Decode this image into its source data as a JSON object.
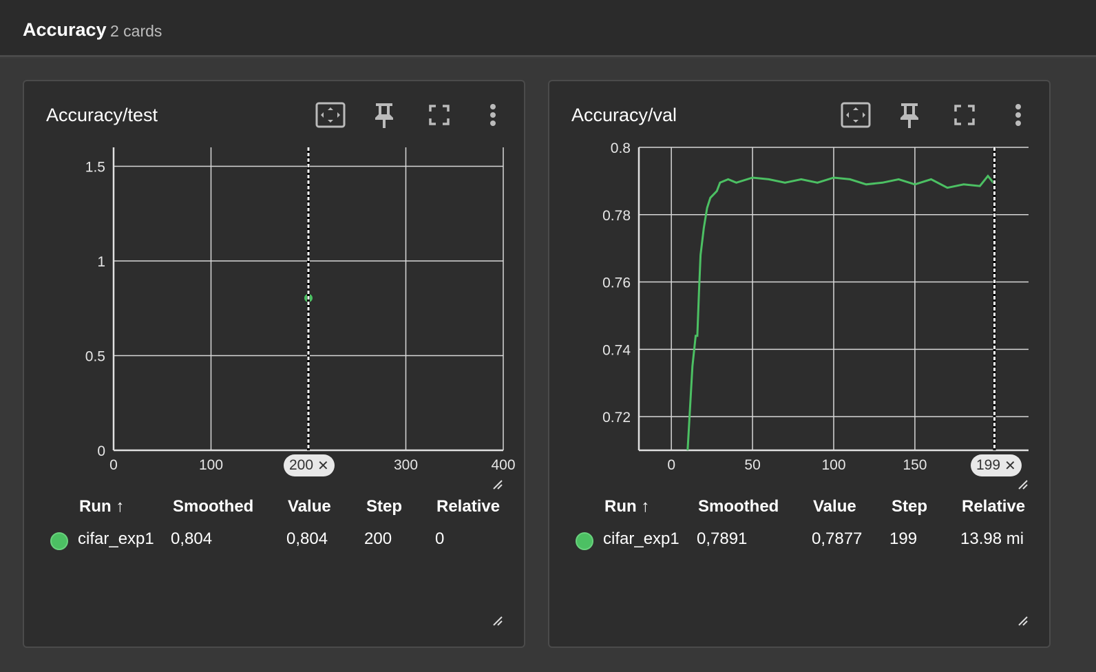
{
  "header": {
    "title": "Accuracy",
    "count": "2 cards"
  },
  "colors": {
    "series": "#4cc063",
    "grid": "#d8d8d8",
    "bg": "#2d2d2d"
  },
  "icons": [
    "fit-domain-icon",
    "pin-icon",
    "fullscreen-icon",
    "more-vert-icon"
  ],
  "cards": [
    {
      "title": "Accuracy/test",
      "chart_data": {
        "type": "scatter",
        "title": "Accuracy/test",
        "x_ticks": [
          "0",
          "100",
          "200",
          "300",
          "400"
        ],
        "y_ticks": [
          "0",
          "0.5",
          "1",
          "1.5"
        ],
        "xlim": [
          0,
          400
        ],
        "ylim": [
          0,
          1.6
        ],
        "series": [
          {
            "name": "cifar_exp1",
            "x": [
              200
            ],
            "y": [
              0.804
            ]
          }
        ],
        "cursor_step": "200"
      },
      "table": {
        "headers": [
          "Run ↑",
          "Smoothed",
          "Value",
          "Step",
          "Relative"
        ],
        "rows": [
          {
            "run": "cifar_exp1",
            "smoothed": "0,804",
            "value": "0,804",
            "step": "200",
            "relative": "0"
          }
        ]
      }
    },
    {
      "title": "Accuracy/val",
      "chart_data": {
        "type": "line",
        "title": "Accuracy/val",
        "x_ticks": [
          "0",
          "50",
          "100",
          "150",
          "199"
        ],
        "y_ticks": [
          "0.72",
          "0.74",
          "0.76",
          "0.78",
          "0.8"
        ],
        "xlim": [
          -20,
          220
        ],
        "ylim": [
          0.71,
          0.8
        ],
        "series": [
          {
            "name": "cifar_exp1",
            "x": [
              10,
              13,
              15,
              16,
              17,
              18,
              20,
              22,
              24,
              26,
              28,
              30,
              35,
              40,
              50,
              60,
              70,
              80,
              90,
              100,
              110,
              120,
              130,
              140,
              150,
              160,
              170,
              180,
              190,
              195,
              199
            ],
            "y": [
              0.71,
              0.735,
              0.744,
              0.744,
              0.757,
              0.768,
              0.776,
              0.782,
              0.785,
              0.786,
              0.787,
              0.7895,
              0.7905,
              0.7895,
              0.791,
              0.7905,
              0.7895,
              0.7905,
              0.7895,
              0.791,
              0.7905,
              0.789,
              0.7895,
              0.7905,
              0.789,
              0.7905,
              0.788,
              0.789,
              0.7885,
              0.7915,
              0.7891
            ]
          }
        ],
        "cursor_step": "199"
      },
      "table": {
        "headers": [
          "Run ↑",
          "Smoothed",
          "Value",
          "Step",
          "Relative"
        ],
        "rows": [
          {
            "run": "cifar_exp1",
            "smoothed": "0,7891",
            "value": "0,7877",
            "step": "199",
            "relative": "13.98 mi"
          }
        ]
      }
    }
  ]
}
